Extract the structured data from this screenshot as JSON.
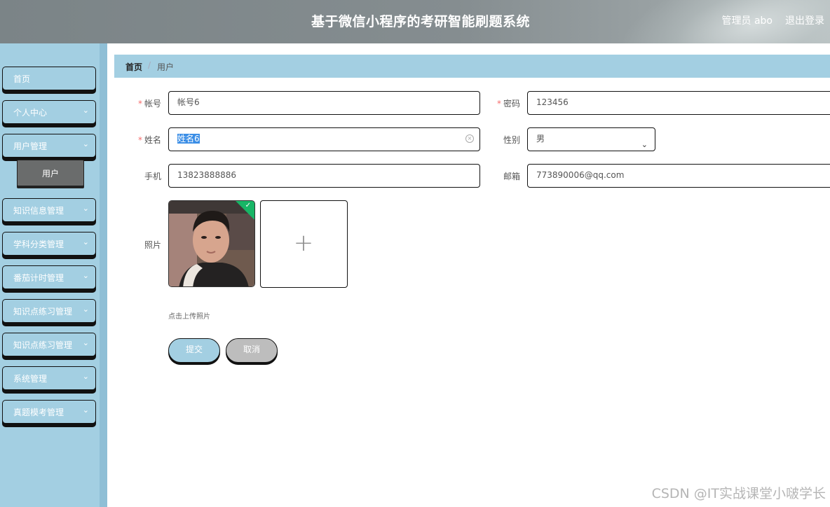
{
  "header": {
    "title": "基于微信小程序的考研智能刷题系统",
    "user": "管理员 abo",
    "logout": "退出登录"
  },
  "sidebar": {
    "items": [
      {
        "label": "首页"
      },
      {
        "label": "个人中心"
      },
      {
        "label": "用户管理"
      },
      {
        "label": "知识信息管理"
      },
      {
        "label": "学科分类管理"
      },
      {
        "label": "番茄计时管理"
      },
      {
        "label": "知识点练习管理"
      },
      {
        "label": "知识点练习管理"
      },
      {
        "label": "系统管理"
      },
      {
        "label": "真题模考管理"
      }
    ],
    "sub_item": "用户"
  },
  "breadcrumb": {
    "home": "首页",
    "separator": "/",
    "current": "用户"
  },
  "form": {
    "account": {
      "label": "帐号",
      "value": "帐号6"
    },
    "password": {
      "label": "密码",
      "value": "123456"
    },
    "name": {
      "label": "姓名",
      "value": "姓名6"
    },
    "gender": {
      "label": "性别",
      "value": "男"
    },
    "phone": {
      "label": "手机",
      "value": "13823888886"
    },
    "email": {
      "label": "邮箱",
      "value": "773890006@qq.com"
    },
    "photo": {
      "label": "照片",
      "hint": "点击上传照片"
    },
    "submit": "提交",
    "cancel": "取消"
  },
  "watermark": "CSDN @IT实战课堂小啵学长",
  "colors": {
    "sidebar": "#a3cfe2",
    "breadcrumb": "#a3cfe2",
    "required": "#f56c6c",
    "cancel": "#bdbdbd",
    "active_submenu": "#6a6c6c",
    "upload_success": "#18b566"
  }
}
